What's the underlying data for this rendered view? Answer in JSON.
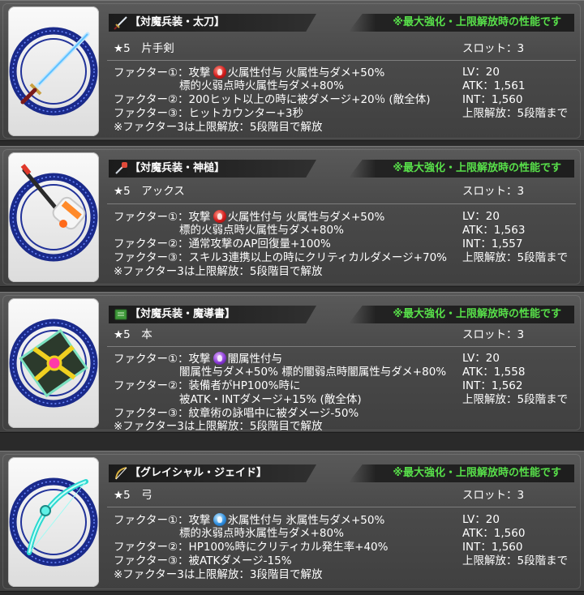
{
  "colors": {
    "performance_note": "#58e04a",
    "card_bg": "#4a4a4a"
  },
  "cards": [
    {
      "weapon_icon": "katana-icon",
      "name": "【対魔兵装・太刀】",
      "performance_note": "※最大強化・上限解放時の性能です",
      "rarity_type": "★5　片手剣",
      "slot": "スロット：3",
      "factor_lines": [
        {
          "text_before": "ファクター①：攻撃",
          "element_icon": "fire-element-icon",
          "text_after": "火属性付与 火属性与ダメ+50%"
        },
        {
          "text": "　　　　　　標的火弱点時火属性与ダメ+80%"
        },
        {
          "text": "ファクター②：200ヒット以上の時に被ダメージ+20％ (敵全体)"
        },
        {
          "text": "ファクター③：ヒットカウンター+3秒"
        },
        {
          "text": "※ファクター3は上限解放：5段階目で解放"
        }
      ],
      "stats": [
        "LV：20",
        "ATK：1,561",
        "INT：1,560",
        "上限解放：5段階まで"
      ]
    },
    {
      "weapon_icon": "axe-icon",
      "name": "【対魔兵装・神槌】",
      "performance_note": "※最大強化・上限解放時の性能です",
      "rarity_type": "★5　アックス",
      "slot": "スロット：3",
      "factor_lines": [
        {
          "text_before": "ファクター①：攻撃",
          "element_icon": "fire-element-icon",
          "text_after": "火属性付与 火属性与ダメ+50%"
        },
        {
          "text": "　　　　　　標的火弱点時火属性与ダメ+80%"
        },
        {
          "text": "ファクター②：通常攻撃のAP回復量+100%"
        },
        {
          "text": "ファクター③：スキル3連携以上の時にクリティカルダメージ+70%"
        },
        {
          "text": "※ファクター3は上限解放：5段階目で解放"
        }
      ],
      "stats": [
        "LV：20",
        "ATK：1,563",
        "INT：1,557",
        "上限解放：5段階まで"
      ]
    },
    {
      "weapon_icon": "book-icon",
      "name": "【対魔兵装・魔導書】",
      "performance_note": "※最大強化・上限解放時の性能です",
      "rarity_type": "★5　本",
      "slot": "スロット：3",
      "factor_lines": [
        {
          "text_before": "ファクター①：攻撃",
          "element_icon": "dark-element-icon",
          "text_after": "闇属性付与"
        },
        {
          "text": "　　　　　　闇属性与ダメ+50% 標的闇弱点時闇属性与ダメ+80%"
        },
        {
          "text": "ファクター②：装備者がHP100%時に"
        },
        {
          "text": "　　　　　　被ATK・INTダメージ+15% (敵全体)"
        },
        {
          "text": "ファクター③：紋章術の詠唱中に被ダメージ-50%"
        },
        {
          "text": "※ファクター3は上限解放：5段階目で解放"
        }
      ],
      "stats": [
        "LV：20",
        "ATK：1,558",
        "INT：1,562",
        "上限解放：5段階まで"
      ]
    },
    {
      "weapon_icon": "bow-icon",
      "name": "【グレイシャル・ジェイド】",
      "performance_note": "※最大強化・上限解放時の性能です",
      "rarity_type": "★5　弓",
      "slot": "スロット：3",
      "factor_lines": [
        {
          "text_before": "ファクター①：攻撃",
          "element_icon": "ice-element-icon",
          "text_after": "氷属性付与 氷属性与ダメ+50%"
        },
        {
          "text": "　　　　　　標的氷弱点時氷属性与ダメ+80%"
        },
        {
          "text": "ファクター②：HP100%時にクリティカル発生率+40%"
        },
        {
          "text": "ファクター③：被ATKダメージ-15%"
        },
        {
          "text": "※ファクター3は上限解放：3段階目で解放"
        }
      ],
      "stats": [
        "LV：20",
        "ATK：1,560",
        "INT：1,560",
        "上限解放：5段階まで"
      ]
    }
  ]
}
